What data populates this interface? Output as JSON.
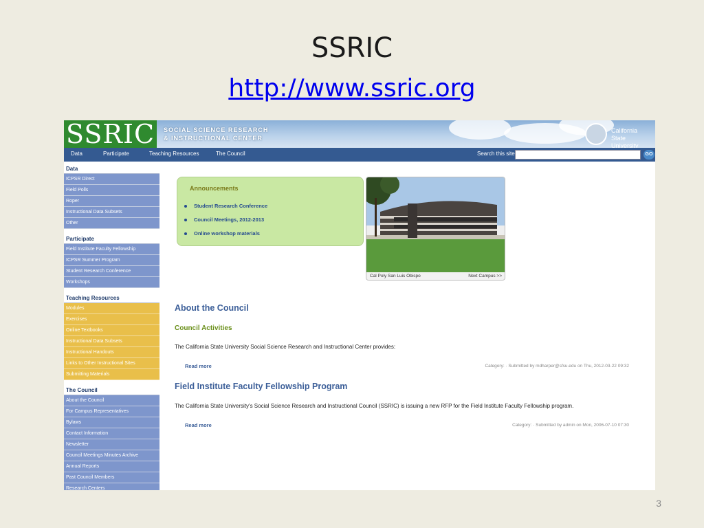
{
  "slide": {
    "title": "SSRIC",
    "link": "http://www.ssric.org",
    "number": "3"
  },
  "site": {
    "logo_text": "SSRIC",
    "org_name_line1": "SOCIAL SCIENCE RESEARCH",
    "org_name_line2": "& INSTRUCTIONAL CENTER",
    "csu_line1": "California",
    "csu_line2": "State University",
    "nav": [
      "Data",
      "Participate",
      "Teaching Resources",
      "The Council"
    ],
    "search_label": "Search this site:",
    "search_value": "",
    "go_label": "GO",
    "sidebar": [
      {
        "heading": "Data",
        "style": "blue",
        "items": [
          "ICPSR Direct",
          "Field Polls",
          "Roper",
          "Instructional Data Subsets",
          "Other"
        ]
      },
      {
        "heading": "Participate",
        "style": "blue",
        "items": [
          "Field Institute Faculty Fellowship",
          "ICPSR Summer Program",
          "Student Research Conference",
          "Workshops"
        ]
      },
      {
        "heading": "Teaching Resources",
        "style": "yellow",
        "items": [
          "Modules",
          "Exercises",
          "Online Textbooks",
          "Instructional Data Subsets",
          "Instructional Handouts",
          "Links to Other Instructional Sites",
          "Submitting Materials"
        ]
      },
      {
        "heading": "The Council",
        "style": "blue",
        "items": [
          "About the Council",
          "For Campus Representatives",
          "Bylaws",
          "Contact Information",
          "Newsletter",
          "Council Meetings Minutes Archive",
          "Annual Reports",
          "Past Council Members",
          "Research Centers"
        ]
      }
    ],
    "announcements": {
      "title": "Announcements",
      "items": [
        "Student Research Conference",
        "Council Meetings, 2012-2013",
        "Online workshop materials"
      ]
    },
    "campus": {
      "caption": "Cal Poly San Luis Obispo",
      "next": "Next Campus >>"
    },
    "about_heading": "About the Council",
    "activities_heading": "Council Activities",
    "post1": {
      "text": "The California State University Social Science Research and Instructional Center provides:",
      "read_more": "Read more",
      "meta": "Category: · Submitted by mdharper@sfsu.edu on Thu, 2012-03-22 09:32"
    },
    "post2": {
      "heading": "Field Institute Faculty Fellowship Program",
      "text": "The California State University's Social Science Research and Instructional Council (SSRIC) is issuing a new RFP for the Field Institute Faculty Fellowship program.",
      "read_more": "Read more",
      "meta": "Category: · Submitted by admin on Mon, 2006-07-10 07:30"
    }
  },
  "colors": {
    "slide_bg": "#eeece1",
    "nav_bar": "#345a91",
    "sidebar_blue": "#7e96cc",
    "sidebar_yellow": "#e9bf4a",
    "announce_bg": "#c9e8a3",
    "heading_blue": "#3b5e98",
    "heading_green": "#6a8f1a"
  }
}
